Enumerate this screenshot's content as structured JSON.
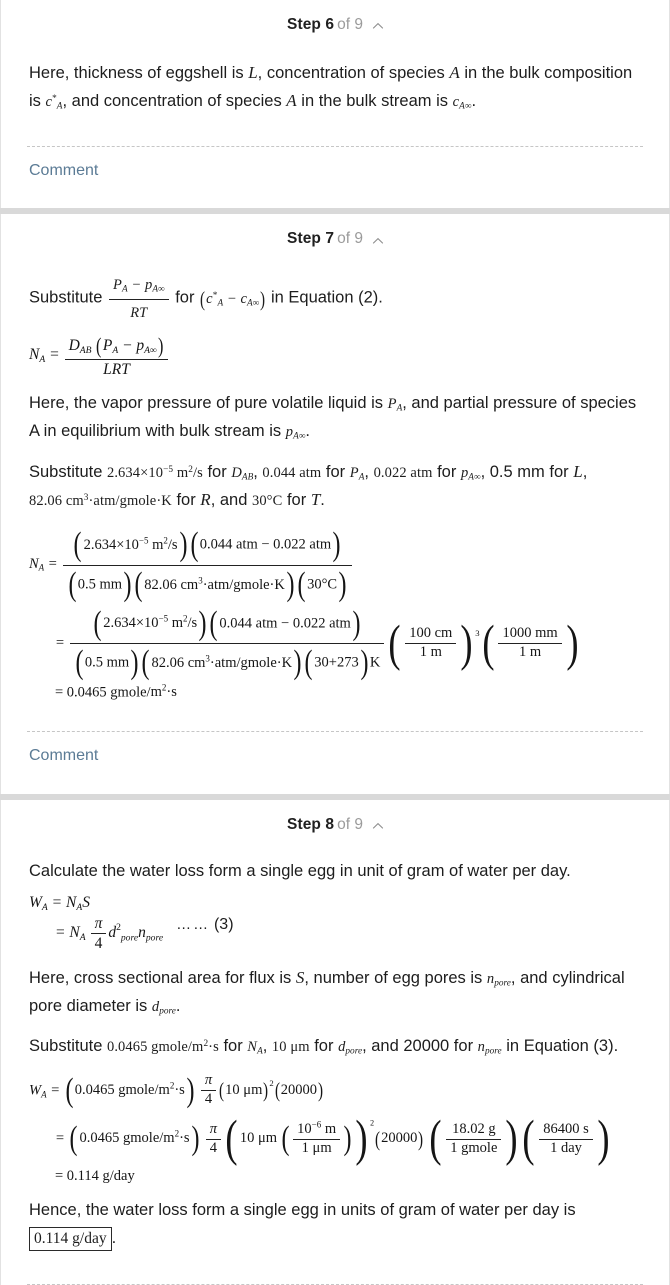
{
  "colors": {
    "page_background": "#d9d9d9",
    "card_background": "#ffffff",
    "text": "#1d1d1d",
    "muted": "#9b9b9b",
    "link": "#5b7b95",
    "divider": "#c6c6c6"
  },
  "steps": [
    {
      "id": "step-6",
      "label": "Step 6",
      "of": "of 9",
      "collapse_icon": "chevron-up-icon",
      "comment_label": "Comment",
      "content": {
        "para1_a": "Here, thickness of eggshell is",
        "para1_L": "L",
        "para1_b": ", concentration of species",
        "para1_A1": "A",
        "para1_c": "in the bulk composition is",
        "math_c_star_A": "c*A",
        "para1_d": ", and concentration of species",
        "para1_A2": "A",
        "para1_e": "in the bulk stream is",
        "math_c_A_inf": "cA∞",
        "para1_f": "."
      }
    },
    {
      "id": "step-7",
      "label": "Step 7",
      "of": "of 9",
      "collapse_icon": "chevron-up-icon",
      "comment_label": "Comment",
      "content": {
        "sub_line_pre": "Substitute",
        "sub_frac_num": "PA − pA∞",
        "sub_frac_den": "RT",
        "sub_line_mid": "for",
        "sub_paren": "(c*A − cA∞)",
        "sub_line_post": "in Equation (2).",
        "eq_na_lhs": "NA =",
        "eq_na_num": "DAB (PA − pA∞)",
        "eq_na_den": "LRT",
        "para_vapor_a": "Here, the vapor pressure of pure volatile liquid is",
        "para_vapor_PA": "PA",
        "para_vapor_b": ", and partial pressure of species A in equilibrium with bulk stream is",
        "para_vapor_pAinf": "pA∞",
        "para_vapor_c": ".",
        "sub2_pre": "Substitute",
        "sub2_val_DAB": "2.634×10−5 m2/s",
        "sub2_for1": "for",
        "sub2_sym_DAB": "DAB",
        "sub2_val_PA": "0.044 atm",
        "sub2_for2": "for",
        "sub2_sym_PA": "PA",
        "sub2_val_pAinf": "0.022 atm",
        "sub2_for3": "for",
        "sub2_sym_pAinf": "pA∞",
        "sub2_val_L": "0.5 mm",
        "sub2_for4": "for",
        "sub2_sym_L": "L",
        "sub2_val_R": "82.06 cm3·atm/gmole·K",
        "sub2_for5": "for",
        "sub2_sym_R": "R",
        "sub2_and": "and",
        "sub2_val_T": "30°C",
        "sub2_for6": "for",
        "sub2_sym_T": "T",
        "sub2_end": ".",
        "calc_line1_num": "(2.634×10−5 m2/s)(0.044 atm − 0.022 atm)",
        "calc_line1_den": "(0.5 mm)(82.06 cm3·atm/gmole·K)(30°C)",
        "calc_line2_num": "(2.634×10−5 m2/s)(0.044 atm − 0.022 atm)",
        "calc_line2_den": "(0.5 mm)(82.06 cm3·atm/gmole·K)(30+273)K",
        "calc_conv1_num": "100 cm",
        "calc_conv1_den": "1 m",
        "calc_conv1_pow": "3",
        "calc_conv2_num": "1000 mm",
        "calc_conv2_den": "1 m",
        "calc_result": "= 0.0465 gmole/m2·s"
      }
    },
    {
      "id": "step-8",
      "label": "Step 8",
      "of": "of 9",
      "collapse_icon": "chevron-up-icon",
      "content": {
        "intro": "Calculate the water loss form a single egg in unit of gram of water per day.",
        "eq3_line1": "WA = NA S",
        "eq3_line2_lead": "= NA",
        "eq3_frac_num": "π",
        "eq3_frac_den": "4",
        "eq3_rest": "d2pore npore",
        "eq3_dots": "……",
        "eq3_tag": "(3)",
        "para_here_a": "Here, cross sectional area for flux is",
        "para_here_S": "S",
        "para_here_b": ", number of egg pores is",
        "para_here_npore": "npore",
        "para_here_c": ", and cylindrical pore diameter is",
        "para_here_dpore": "dpore",
        "para_here_d": ".",
        "sub3_pre": "Substitute",
        "sub3_val_NA": "0.0465 gmole/m2·s",
        "sub3_for1": "for",
        "sub3_sym_NA": "NA",
        "sub3_val_dpore": "10 μm",
        "sub3_for2": "for",
        "sub3_sym_dpore": "dpore",
        "sub3_and": ", and 20000 for",
        "sub3_sym_npore": "npore",
        "sub3_in": "in Equation (3).",
        "final_line1": "WA = (0.0465 gmole/m2·s) π/4 (10 μm)2 (20000)",
        "final_line2_a": "= (0.0465 gmole/m2·s)",
        "final_line2_frac_num": "π",
        "final_line2_frac_den": "4",
        "final_line2_inner": "10 μm",
        "final_conv_num": "10−6 m",
        "final_conv_den": "1 μm",
        "final_sq": "2",
        "final_20000": "(20000)",
        "final_mm_num": "18.02 g",
        "final_mm_den": "1 gmole",
        "final_time_num": "86400 s",
        "final_time_den": "1 day",
        "final_result": "= 0.114 g/day",
        "hence_text": "Hence, the water loss form a single egg in units of gram of water per day is",
        "boxed_answer": "0.114 g/day",
        "hence_period": "."
      }
    }
  ]
}
